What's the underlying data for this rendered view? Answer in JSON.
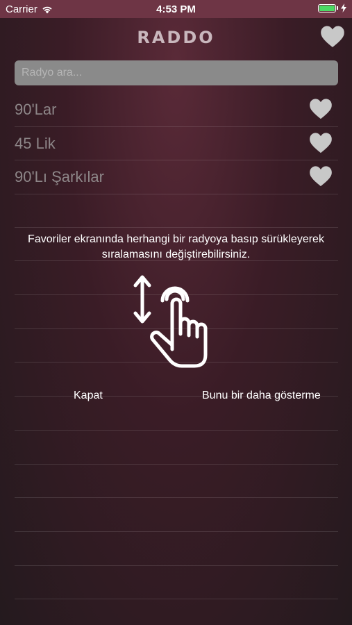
{
  "status_bar": {
    "carrier": "Carrier",
    "time": "4:53 PM"
  },
  "header": {
    "logo": "RADDO",
    "favorites_icon": "heart-icon"
  },
  "search": {
    "placeholder": "Radyo ara...",
    "value": ""
  },
  "stations": [
    {
      "name": "90'Lar",
      "icon": "heart-icon"
    },
    {
      "name": "45 Lik",
      "icon": "heart-icon"
    },
    {
      "name": "90'Lı Şarkılar",
      "icon": "heart-icon"
    }
  ],
  "tutorial": {
    "message": "Favoriler ekranında herhangi bir radyoya basıp sürükleyerek sıralamasını değiştirebilirsiniz.",
    "close_label": "Kapat",
    "dont_show_label": "Bunu bir daha gösterme",
    "icon": "drag-gesture-icon"
  },
  "colors": {
    "status_bar": "#6e3545",
    "battery": "#4cd964",
    "heart": "#c8c8c8",
    "search_bg": "#8a8a8a"
  }
}
